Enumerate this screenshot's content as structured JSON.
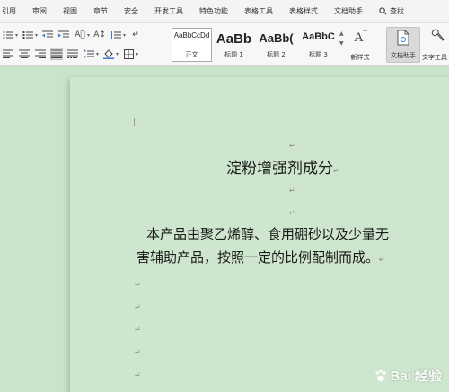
{
  "menu": {
    "items": [
      "引用",
      "审阅",
      "视图",
      "章节",
      "安全",
      "开发工具",
      "特色功能",
      "表格工具",
      "表格样式",
      "文档助手"
    ],
    "search_label": "查找"
  },
  "styles": [
    {
      "preview": "AaBbCcDd",
      "name": "正文"
    },
    {
      "preview": "AaBb",
      "name": "标题 1"
    },
    {
      "preview": "AaBb(",
      "name": "标题 2"
    },
    {
      "preview": "AaBbC",
      "name": "标题 3"
    }
  ],
  "buttons": {
    "new_style": "新样式",
    "doc_assistant": "文档助手",
    "text_tools": "文字工具"
  },
  "document": {
    "title": "淀粉增强剂成分",
    "para_line1": "本产品由聚乙烯醇、食用硼砂以及少量无",
    "para_line2": "害辅助产品，按照一定的比例配制而成。",
    "paragraph_mark": "↵"
  },
  "watermark": {
    "text": "Bai 经验"
  }
}
